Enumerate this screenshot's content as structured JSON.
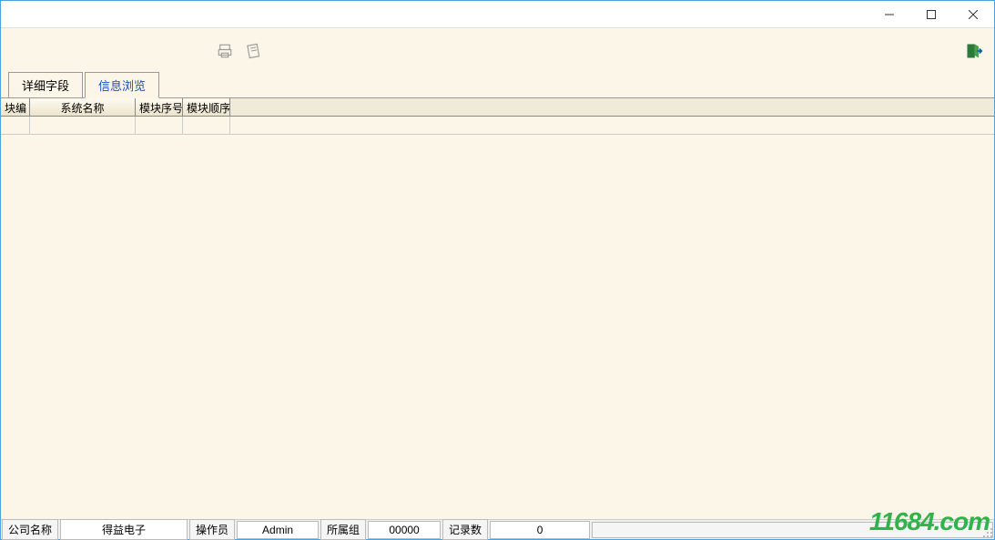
{
  "window": {
    "minimize": "minimize",
    "maximize": "maximize",
    "close": "close"
  },
  "toolbar": {
    "print_icon": "print-icon",
    "preview_icon": "preview-icon",
    "exit_icon": "exit-icon"
  },
  "tabs": [
    {
      "label": "详细字段",
      "active": false
    },
    {
      "label": "信息浏览",
      "active": true
    }
  ],
  "grid": {
    "columns": [
      "块编",
      "系统名称",
      "模块序号",
      "模块顺序"
    ],
    "rows": [
      [
        "",
        "",
        "",
        ""
      ]
    ]
  },
  "statusbar": {
    "company_label": "公司名称",
    "company_value": "得益电子",
    "operator_label": "操作员",
    "operator_value": "Admin",
    "group_label": "所属组",
    "group_value": "00000",
    "records_label": "记录数",
    "records_value": "0"
  },
  "watermark": "11684.com"
}
